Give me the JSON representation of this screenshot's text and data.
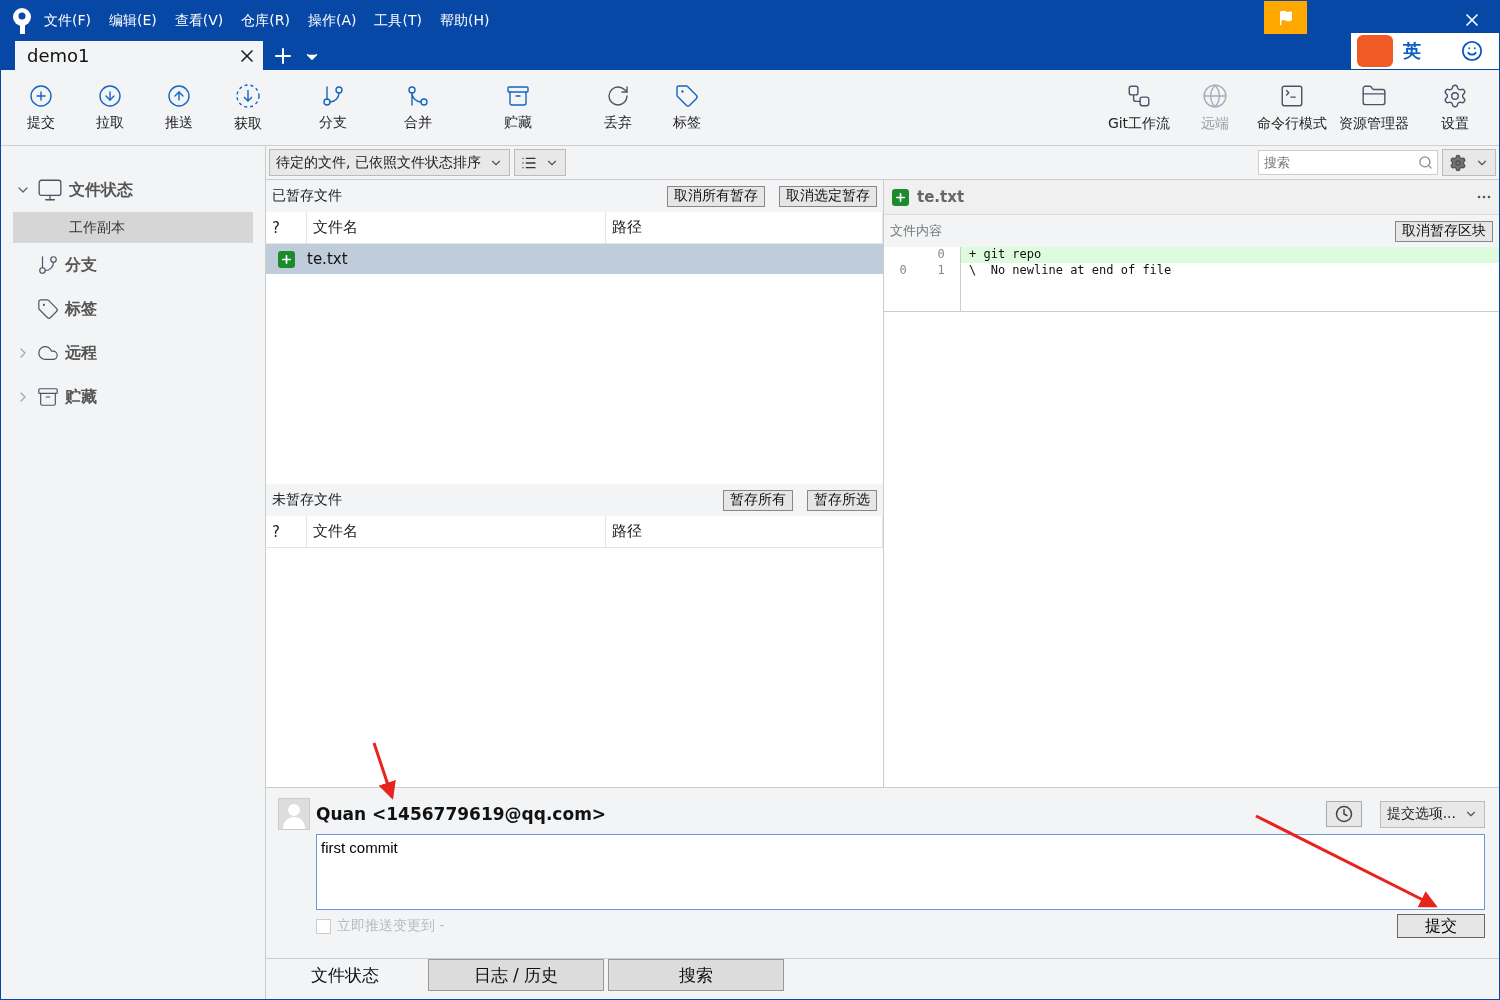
{
  "menu": [
    "文件(F)",
    "编辑(E)",
    "查看(V)",
    "仓库(R)",
    "操作(A)",
    "工具(T)",
    "帮助(H)"
  ],
  "tabs": [
    {
      "label": "demo1",
      "selected": true
    }
  ],
  "ime": {
    "mode": "英"
  },
  "toolbar_left": [
    {
      "label": "提交"
    },
    {
      "label": "拉取"
    },
    {
      "label": "推送"
    },
    {
      "label": "获取"
    },
    {
      "label": "分支"
    },
    {
      "label": "合并"
    },
    {
      "label": "贮藏"
    },
    {
      "label": "丢弃"
    },
    {
      "label": "标签"
    }
  ],
  "toolbar_right": [
    {
      "label": "Git工作流",
      "disabled": false
    },
    {
      "label": "远端",
      "disabled": true
    },
    {
      "label": "命令行模式",
      "disabled": false
    },
    {
      "label": "资源管理器",
      "disabled": false
    },
    {
      "label": "设置",
      "disabled": false
    }
  ],
  "sidebar": [
    {
      "label": "文件状态",
      "expanded": true,
      "children": [
        {
          "label": "工作副本",
          "selected": true
        }
      ]
    },
    {
      "label": "分支"
    },
    {
      "label": "标签"
    },
    {
      "label": "远程",
      "expanded": false
    },
    {
      "label": "贮藏",
      "expanded": false
    }
  ],
  "filter": {
    "sort": "待定的文件, 已依照文件状态排序"
  },
  "search": {
    "placeholder": "搜索"
  },
  "staged": {
    "title": "已暂存文件",
    "buttons": [
      "取消所有暂存",
      "取消选定暂存"
    ],
    "columns": [
      "?",
      "文件名",
      "路径"
    ],
    "rows": [
      {
        "name": "te.txt",
        "selected": true
      }
    ]
  },
  "unstaged": {
    "title": "未暂存文件",
    "buttons": [
      "暂存所有",
      "暂存所选"
    ],
    "columns": [
      "?",
      "文件名",
      "路径"
    ]
  },
  "diff": {
    "file": "te.txt",
    "section": "文件内容",
    "button": "取消暂存区块",
    "lines": [
      {
        "new": "0",
        "text": "+ git repo",
        "kind": "added"
      },
      {
        "old": "0",
        "new": "1",
        "text": "\\  No newline at end of file",
        "kind": "context"
      }
    ]
  },
  "commit": {
    "author": "Quan <1456779619@qq.com>",
    "message": "first commit",
    "options": "提交选项...",
    "push_label": "立即推送变更到 -",
    "push_checked": false,
    "submit": "提交"
  },
  "bottom_tabs": [
    {
      "label": "文件状态",
      "selected": true
    },
    {
      "label": "日志 / 历史",
      "selected": false
    },
    {
      "label": "搜索",
      "selected": false
    }
  ]
}
